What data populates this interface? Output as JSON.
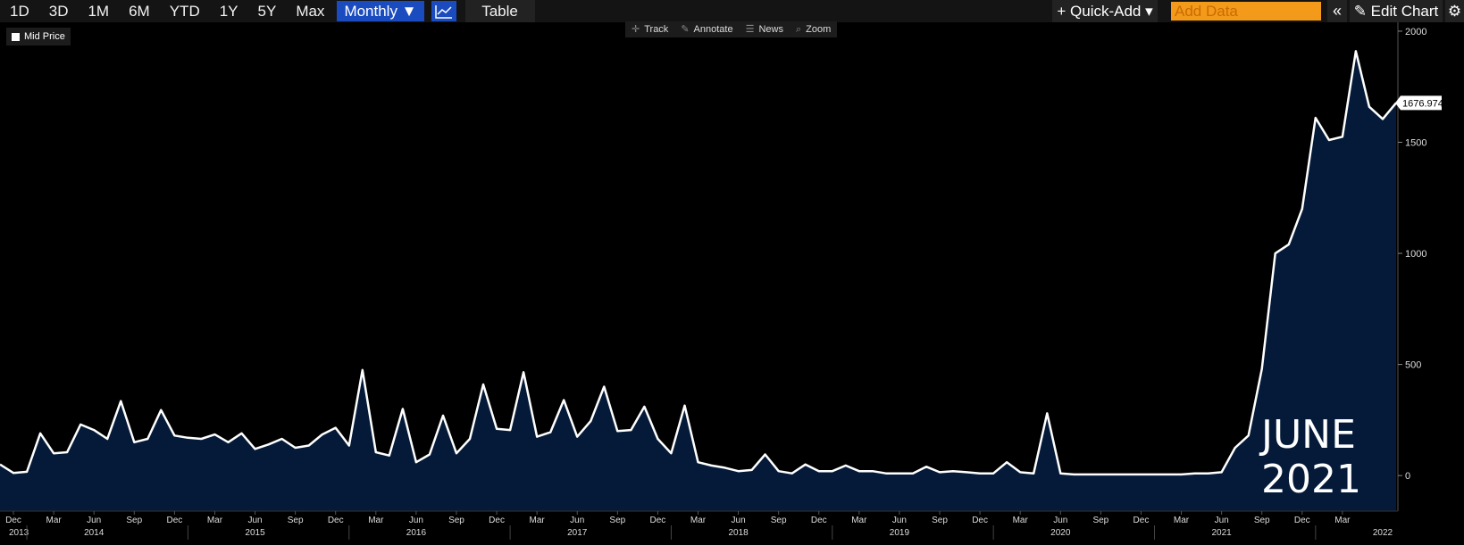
{
  "toolbar": {
    "ranges": [
      "1D",
      "3D",
      "1M",
      "6M",
      "YTD",
      "1Y",
      "5Y",
      "Max"
    ],
    "frequency": "Monthly ▼",
    "chart_icon": "line-chart-icon",
    "table": "Table",
    "quick_add": "+ Quick-Add ▾",
    "add_data_placeholder": "Add Data",
    "collapse": "«",
    "edit_chart": "✎ Edit Chart",
    "settings_icon": "gear-icon"
  },
  "legend": {
    "label": "Mid Price"
  },
  "tools": [
    "Track",
    "Annotate",
    "News",
    "Zoom"
  ],
  "annotation": {
    "line1": "JUNE",
    "line2": "2021"
  },
  "colors": {
    "area": "#041a38",
    "line": "#ffffff",
    "accent": "#1a4bbf",
    "add_data": "#f39a1b"
  },
  "chart_data": {
    "type": "area",
    "x_start": "2012-11",
    "frequency": "monthly",
    "series": [
      {
        "values": [
          50,
          12,
          17,
          190,
          100,
          105,
          230,
          205,
          165,
          335,
          150,
          165,
          295,
          180,
          170,
          165,
          185,
          150,
          190,
          120,
          140,
          165,
          125,
          135,
          185,
          215,
          135,
          475,
          105,
          90,
          300,
          60,
          95,
          270,
          100,
          165,
          410,
          210,
          205,
          465,
          175,
          195,
          340,
          175,
          245,
          400,
          200,
          205,
          310,
          165,
          100,
          315,
          60,
          45,
          35,
          20,
          25,
          95,
          20,
          10,
          50,
          20,
          20,
          45,
          20,
          20,
          10,
          10,
          10,
          40,
          15,
          20,
          15,
          10,
          10,
          60,
          15,
          10,
          280,
          10,
          5,
          5,
          5,
          5,
          5,
          5,
          5,
          5,
          5,
          10,
          10,
          15,
          125,
          180,
          480,
          1000,
          1040,
          1200,
          1610,
          1510,
          1525,
          1910,
          1660,
          1605,
          1676.974
        ]
      }
    ],
    "last_value_label": "1676.974",
    "y_ticks": [
      "0",
      "500",
      "1000",
      "1500",
      "2000"
    ],
    "ylim": [
      -160,
      2040
    ],
    "month_labels": [
      "Dec",
      "Mar",
      "Jun",
      "Sep",
      "Dec",
      "Mar",
      "Jun",
      "Sep",
      "Dec",
      "Mar",
      "Jun",
      "Sep",
      "Dec",
      "Mar",
      "Jun",
      "Sep",
      "Dec",
      "Mar",
      "Jun",
      "Sep",
      "Dec",
      "Mar",
      "Jun",
      "Sep",
      "Dec",
      "Mar",
      "Jun",
      "Sep",
      "Dec",
      "Mar",
      "Jun",
      "Sep",
      "Dec",
      "Mar"
    ],
    "year_labels": [
      "2013",
      "2014",
      "2015",
      "2016",
      "2017",
      "2018",
      "2019",
      "2020",
      "2021",
      "2022"
    ],
    "grid": false,
    "legend_position": "top-left"
  }
}
